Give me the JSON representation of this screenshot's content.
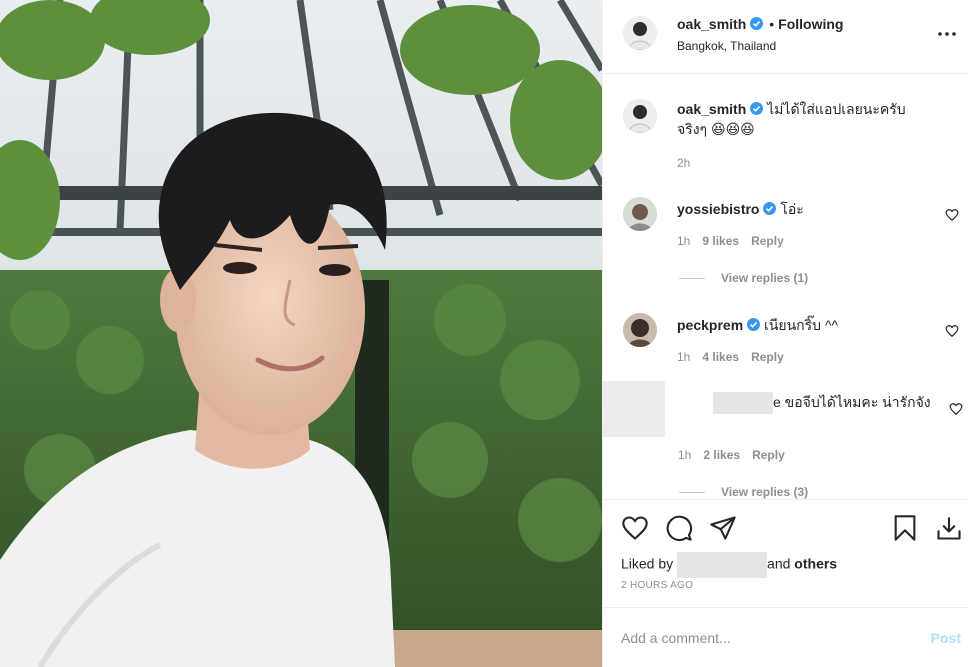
{
  "post": {
    "author": "oak_smith",
    "follow_separator": "•",
    "follow_status": "Following",
    "location": "Bangkok, Thailand"
  },
  "caption": {
    "author": "oak_smith",
    "text": "ไม่ได้ใส่แอปเลยนะครับ จริงๆ 😆😆😆",
    "time": "2h"
  },
  "comments": [
    {
      "author": "yossiebistro",
      "text": "โอ่ะ",
      "time": "1h",
      "likes": "9 likes",
      "reply": "Reply",
      "view_replies": "View replies (1)"
    },
    {
      "author": "peckprem",
      "text": "เนียนกริ๊บ ^^",
      "time": "1h",
      "likes": "4 likes",
      "reply": "Reply"
    },
    {
      "author_hidden": true,
      "text": "e ขอจีบได้ไหมคะ น่ารักจัง",
      "time": "1h",
      "likes": "2 likes",
      "reply": "Reply",
      "view_replies": "View replies (3)"
    }
  ],
  "likes": {
    "prefix": "Liked by",
    "joiner": "and",
    "others": "others"
  },
  "timestamp": "2 HOURS AGO",
  "composer": {
    "placeholder": "Add a comment...",
    "post_label": "Post"
  },
  "colors": {
    "verified": "#3897f0",
    "muted": "#8e8e8e",
    "post_disabled": "#b2dffc"
  },
  "icons": [
    "more-icon",
    "verified-icon",
    "heart-icon",
    "comment-icon",
    "share-icon",
    "bookmark-icon",
    "download-icon"
  ]
}
